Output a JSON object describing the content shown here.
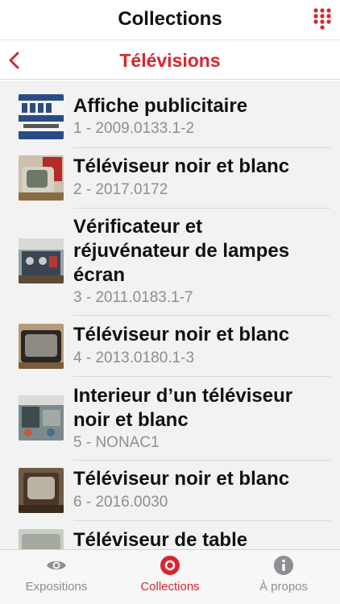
{
  "header": {
    "title": "Collections",
    "menu_icon": "grid-dots-icon"
  },
  "subheader": {
    "title": "Télévisions",
    "back_icon": "chevron-left-icon"
  },
  "items": [
    {
      "title": "Affiche publicitaire",
      "subtitle": "1 - 2009.0133.1-2"
    },
    {
      "title": "Téléviseur noir et blanc",
      "subtitle": "2 - 2017.0172"
    },
    {
      "title": "Vérificateur et réjuvénateur de lampes écran",
      "subtitle": "3 - 2011.0183.1-7"
    },
    {
      "title": "Téléviseur noir et blanc",
      "subtitle": "4 - 2013.0180.1-3"
    },
    {
      "title": "Interieur d’un téléviseur noir et blanc",
      "subtitle": "5 - NONAC1"
    },
    {
      "title": "Téléviseur noir et blanc",
      "subtitle": "6 - 2016.0030"
    },
    {
      "title": "Téléviseur de table",
      "subtitle": ""
    }
  ],
  "tabs": [
    {
      "label": "Expositions",
      "icon": "eye-icon",
      "active": false
    },
    {
      "label": "Collections",
      "icon": "collections-icon",
      "active": true
    },
    {
      "label": "À propos",
      "icon": "info-icon",
      "active": false
    }
  ],
  "colors": {
    "accent": "#d8252e",
    "muted": "#8e8e93",
    "list_bg": "#f2f2f2"
  }
}
